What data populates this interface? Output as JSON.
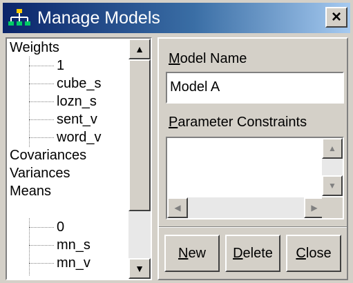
{
  "window": {
    "title": "Manage Models",
    "close_label": "×"
  },
  "tree": {
    "items": [
      {
        "label": "Weights",
        "level": 0
      },
      {
        "label": "1",
        "level": 1
      },
      {
        "label": "cube_s",
        "level": 1
      },
      {
        "label": "lozn_s",
        "level": 1
      },
      {
        "label": "sent_v",
        "level": 1
      },
      {
        "label": "word_v",
        "level": 1
      },
      {
        "label": "Covariances",
        "level": 0
      },
      {
        "label": "Variances",
        "level": 0
      },
      {
        "label": "Means",
        "level": 0
      },
      {
        "label": "0",
        "level": 1
      },
      {
        "label": "mn_s",
        "level": 1
      },
      {
        "label": "mn_v",
        "level": 1
      }
    ]
  },
  "model_name": {
    "accel": "M",
    "rest": "odel Name",
    "value": "Model A"
  },
  "constraints": {
    "accel": "P",
    "rest": "arameter Constraints",
    "value": ""
  },
  "buttons": {
    "new": {
      "accel": "N",
      "rest": "ew"
    },
    "delete": {
      "accel": "D",
      "rest": "elete"
    },
    "close": {
      "accel": "C",
      "rest": "lose"
    }
  },
  "scroll_glyphs": {
    "up": "▲",
    "down": "▼",
    "left": "◀",
    "right": "▶"
  }
}
